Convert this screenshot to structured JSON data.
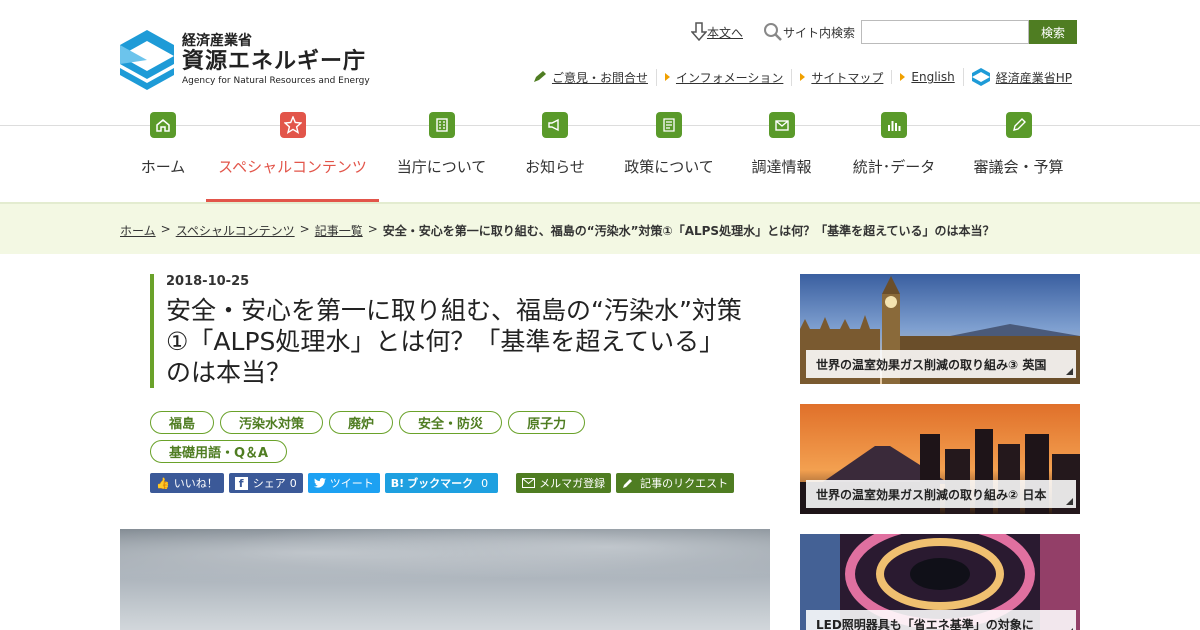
{
  "header": {
    "ministry": "経済産業省",
    "agency": "資源エネルギー庁",
    "agency_en": "Agency for Natural Resources and Energy",
    "skip_link": "本文へ",
    "search_label": "サイト内検索",
    "search_placeholder": "",
    "search_button": "検索",
    "sub_links": [
      "ご意見・お問合せ",
      "インフォメーション",
      "サイトマップ",
      "English",
      "経済産業省HP"
    ]
  },
  "nav": [
    {
      "label": "ホーム",
      "icon": "home-icon"
    },
    {
      "label": "スペシャルコンテンツ",
      "icon": "star-icon",
      "active": true
    },
    {
      "label": "当庁について",
      "icon": "building-icon"
    },
    {
      "label": "お知らせ",
      "icon": "megaphone-icon"
    },
    {
      "label": "政策について",
      "icon": "document-icon"
    },
    {
      "label": "調達情報",
      "icon": "mail-icon"
    },
    {
      "label": "統計･データ",
      "icon": "chart-icon"
    },
    {
      "label": "審議会・予算",
      "icon": "pencil-icon"
    }
  ],
  "breadcrumb": {
    "items": [
      "ホーム",
      "スペシャルコンテンツ",
      "記事一覧"
    ],
    "current": "安全・安心を第一に取り組む、福島の“汚染水”対策①「ALPS処理水」とは何？「基準を超えている」のは本当？"
  },
  "article": {
    "date": "2018-10-25",
    "title": "安全・安心を第一に取り組む、福島の“汚染水”対策①「ALPS処理水」とは何？「基準を超えている」のは本当？",
    "tags": [
      "福島",
      "汚染水対策",
      "廃炉",
      "安全・防災",
      "原子力",
      "基礎用語・Q＆A"
    ]
  },
  "share": {
    "like": "いいね！",
    "share": "シェア",
    "share_count": "0",
    "tweet": "ツイート",
    "bookmark": "ブックマーク",
    "bookmark_count": "0",
    "mailmag": "メルマガ登録",
    "request": "記事のリクエスト"
  },
  "sidebar": {
    "cards": [
      {
        "caption": "世界の温室効果ガス削減の取り組み③ 英国"
      },
      {
        "caption": "世界の温室効果ガス削減の取り組み② 日本"
      },
      {
        "caption": "LED照明器具も「省エネ基準」の対象に"
      }
    ]
  },
  "colors": {
    "accent_green": "#4f7d22",
    "active_red": "#e2554a",
    "breadcrumb_bg": "#f3f8e3"
  }
}
